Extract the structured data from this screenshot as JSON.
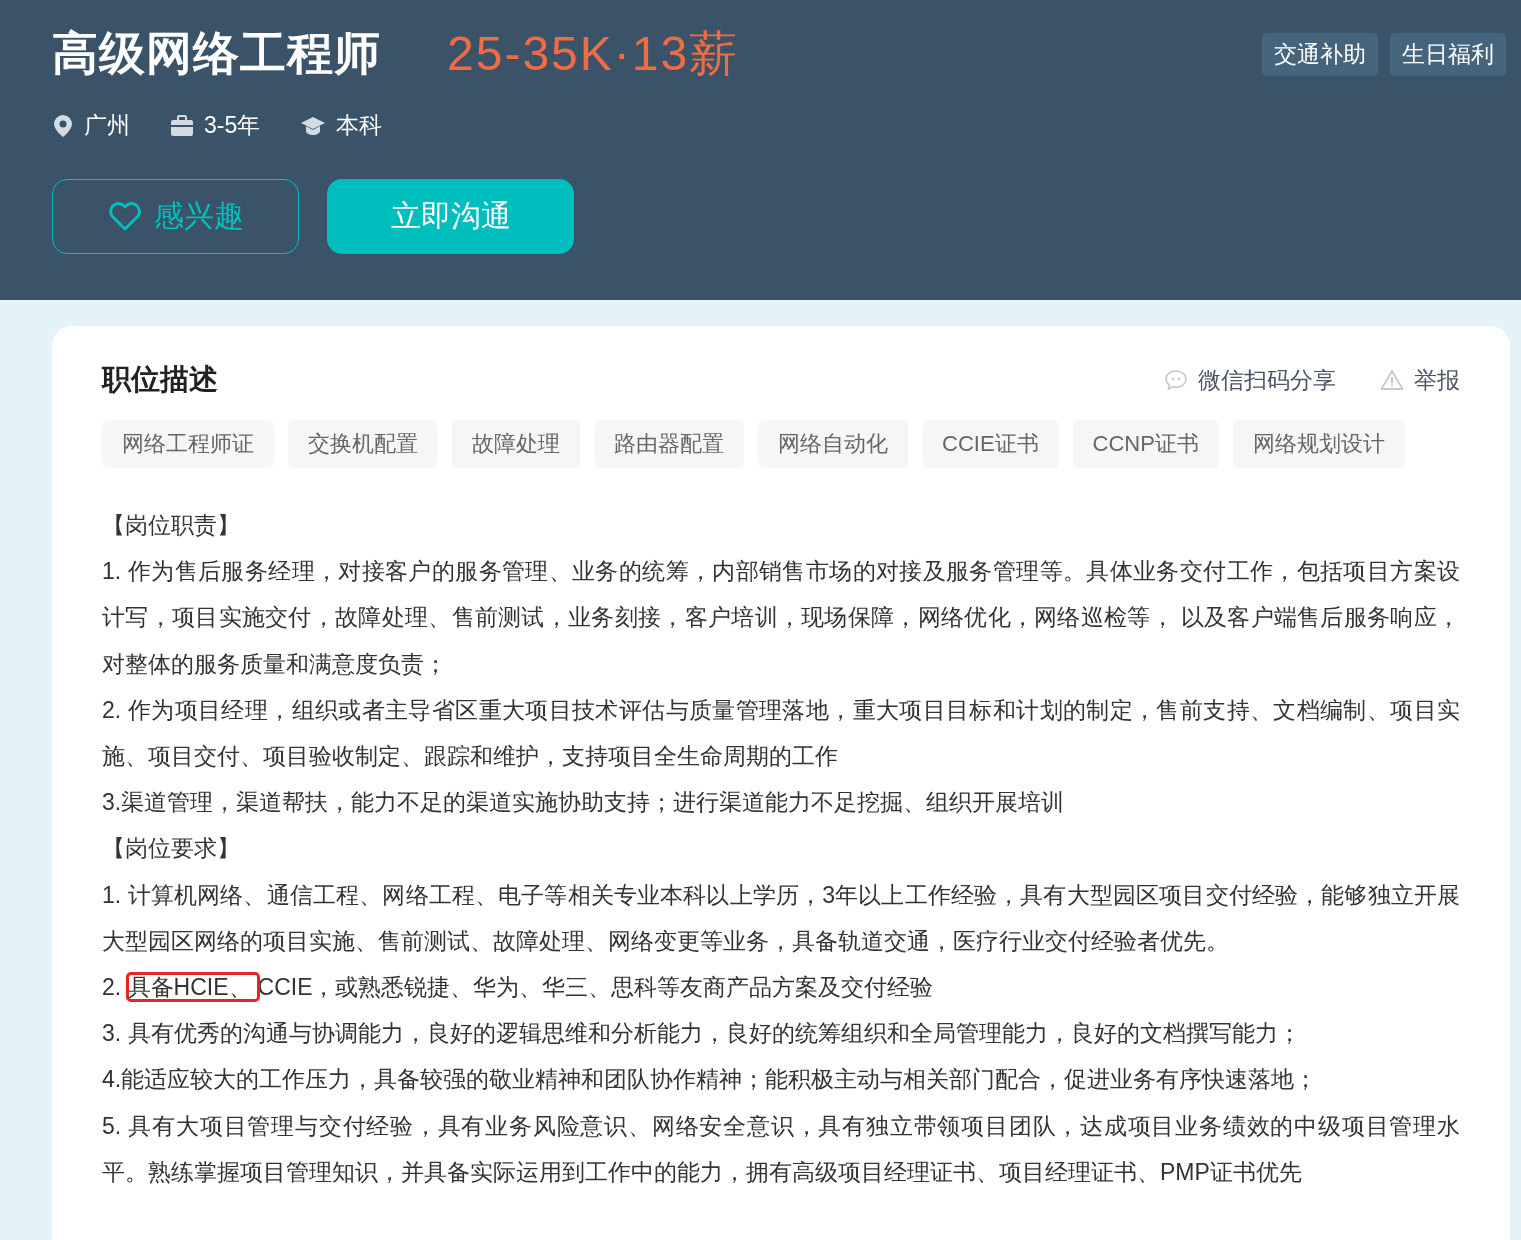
{
  "job": {
    "title": "高级网络工程师",
    "salary": "25-35K·13薪",
    "benefits": [
      "交通补助",
      "生日福利"
    ],
    "meta": [
      {
        "kind": "location",
        "text": "广州"
      },
      {
        "kind": "experience",
        "text": "3-5年"
      },
      {
        "kind": "degree",
        "text": "本科"
      }
    ],
    "buttons": [
      {
        "kind": "interest",
        "label": "感兴趣"
      },
      {
        "kind": "chat",
        "label": "立即沟通"
      }
    ]
  },
  "description": {
    "title": "职位描述",
    "actions": [
      {
        "kind": "share",
        "label": "微信扫码分享"
      },
      {
        "kind": "report",
        "label": "举报"
      }
    ],
    "tags": [
      "网络工程师证",
      "交换机配置",
      "故障处理",
      "路由器配置",
      "网络自动化",
      "CCIE证书",
      "CCNP证书",
      "网络规划设计"
    ],
    "paragraphs": [
      {
        "text": "【岗位职责】"
      },
      {
        "text": "1. 作为售后服务经理，对接客户的服务管理、业务的统筹，内部销售市场的对接及服务管理等。具体业务交付工作，包括项目方案设计写，项目实施交付，故障处理、售前测试，业务刻接，客户培训，现场保障，网络优化，网络巡检等， 以及客户端售后服务响应，对整体的服务质量和满意度负责；"
      },
      {
        "text": "2. 作为项目经理，组织或者主导省区重大项目技术评估与质量管理落地，重大项目目标和计划的制定，售前支持、文档编制、项目实施、项目交付、项目验收制定、跟踪和维护，支持项目全生命周期的工作"
      },
      {
        "text": "3.渠道管理，渠道帮扶，能力不足的渠道实施协助支持；进行渠道能力不足挖掘、组织开展培训"
      },
      {
        "text": "【岗位要求】"
      },
      {
        "text": "1. 计算机网络、通信工程、网络工程、电子等相关专业本科以上学历，3年以上工作经验，具有大型园区项目交付经验，能够独立开展大型园区网络的项目实施、售前测试、故障处理、网络变更等业务，具备轨道交通，医疗行业交付经验者优先。"
      },
      {
        "text": "2. ",
        "annotated": "具备HCIE、",
        "text_after": "CCIE，或熟悉锐捷、华为、华三、思科等友商产品方案及交付经验"
      },
      {
        "text": "3. 具有优秀的沟通与协调能力，良好的逻辑思维和分析能力，良好的统筹组织和全局管理能力，良好的文档撰写能力；"
      },
      {
        "text": "4.能适应较大的工作压力，具备较强的敬业精神和团队协作精神；能积极主动与相关部门配合，促进业务有序快速落地；"
      },
      {
        "text": "5. 具有大项目管理与交付经验，具有业务风险意识、网络安全意识，具有独立带领项目团队，达成项目业务绩效的中级项目管理水平。熟练掌握项目管理知识，并具备实际运用到工作中的能力，拥有高级项目经理证书、项目经理证书、PMP证书优先"
      }
    ]
  }
}
